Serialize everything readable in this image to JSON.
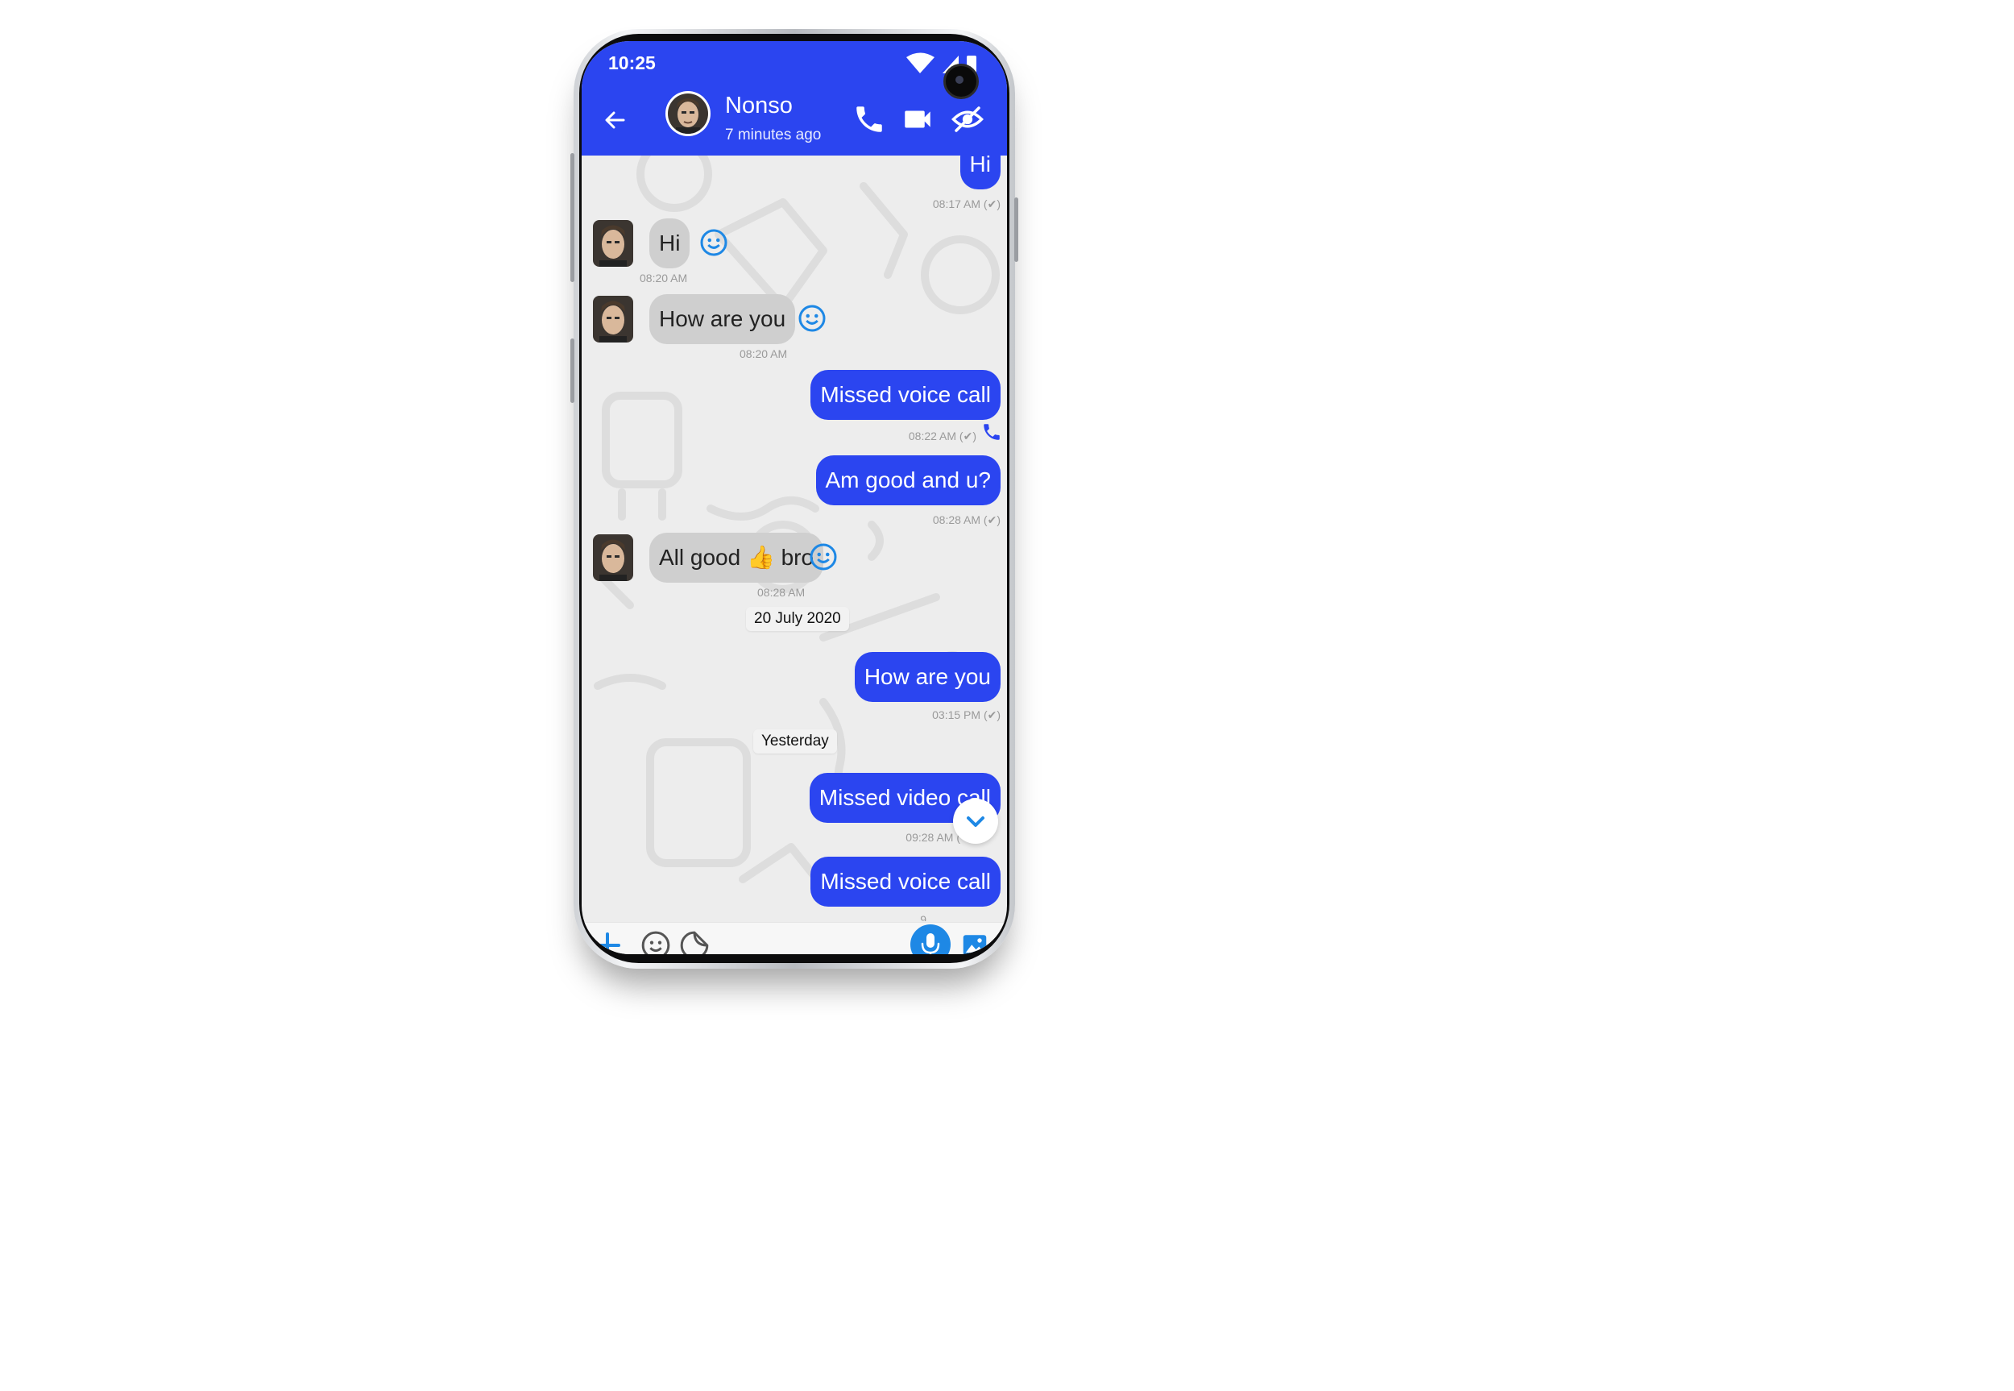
{
  "status_bar": {
    "time": "10:25"
  },
  "header": {
    "contact_name": "Nonso",
    "last_seen": "7 minutes ago",
    "icons": [
      "back-arrow-icon",
      "avatar",
      "phone-icon",
      "video-camera-icon",
      "eye-off-icon"
    ]
  },
  "messages": [
    {
      "direction": "out",
      "text": "Hi",
      "time": "08:17 AM (✔)"
    },
    {
      "direction": "in",
      "text": "Hi",
      "time": "08:20 AM"
    },
    {
      "direction": "in",
      "text": "How are you",
      "time": "08:20 AM"
    },
    {
      "direction": "out",
      "text": "Missed voice call",
      "time": "08:22 AM (✔)"
    },
    {
      "direction": "out",
      "text": "Am good and u?",
      "time": "08:28 AM (✔)"
    },
    {
      "direction": "in",
      "text": "All good 👍 bro",
      "time": "08:28 AM"
    },
    {
      "direction": "date",
      "text": "20 July 2020"
    },
    {
      "direction": "out",
      "text": "How are you",
      "time": "03:15 PM (✔)"
    },
    {
      "direction": "date",
      "text": "Yesterday"
    },
    {
      "direction": "out",
      "text": "Missed video call",
      "time": "09:28 AM ("
    },
    {
      "direction": "out",
      "text": "Missed voice call",
      "time": "9"
    }
  ],
  "composer": {
    "icons": [
      "plus-icon",
      "emoji-icon",
      "sticker-icon",
      "mic-icon",
      "image-icon"
    ]
  },
  "colors": {
    "primary": "#2b45f0",
    "incoming_bubble": "#cfcfcf",
    "chat_background": "#ededed",
    "accent_icon": "#1e88e5"
  }
}
